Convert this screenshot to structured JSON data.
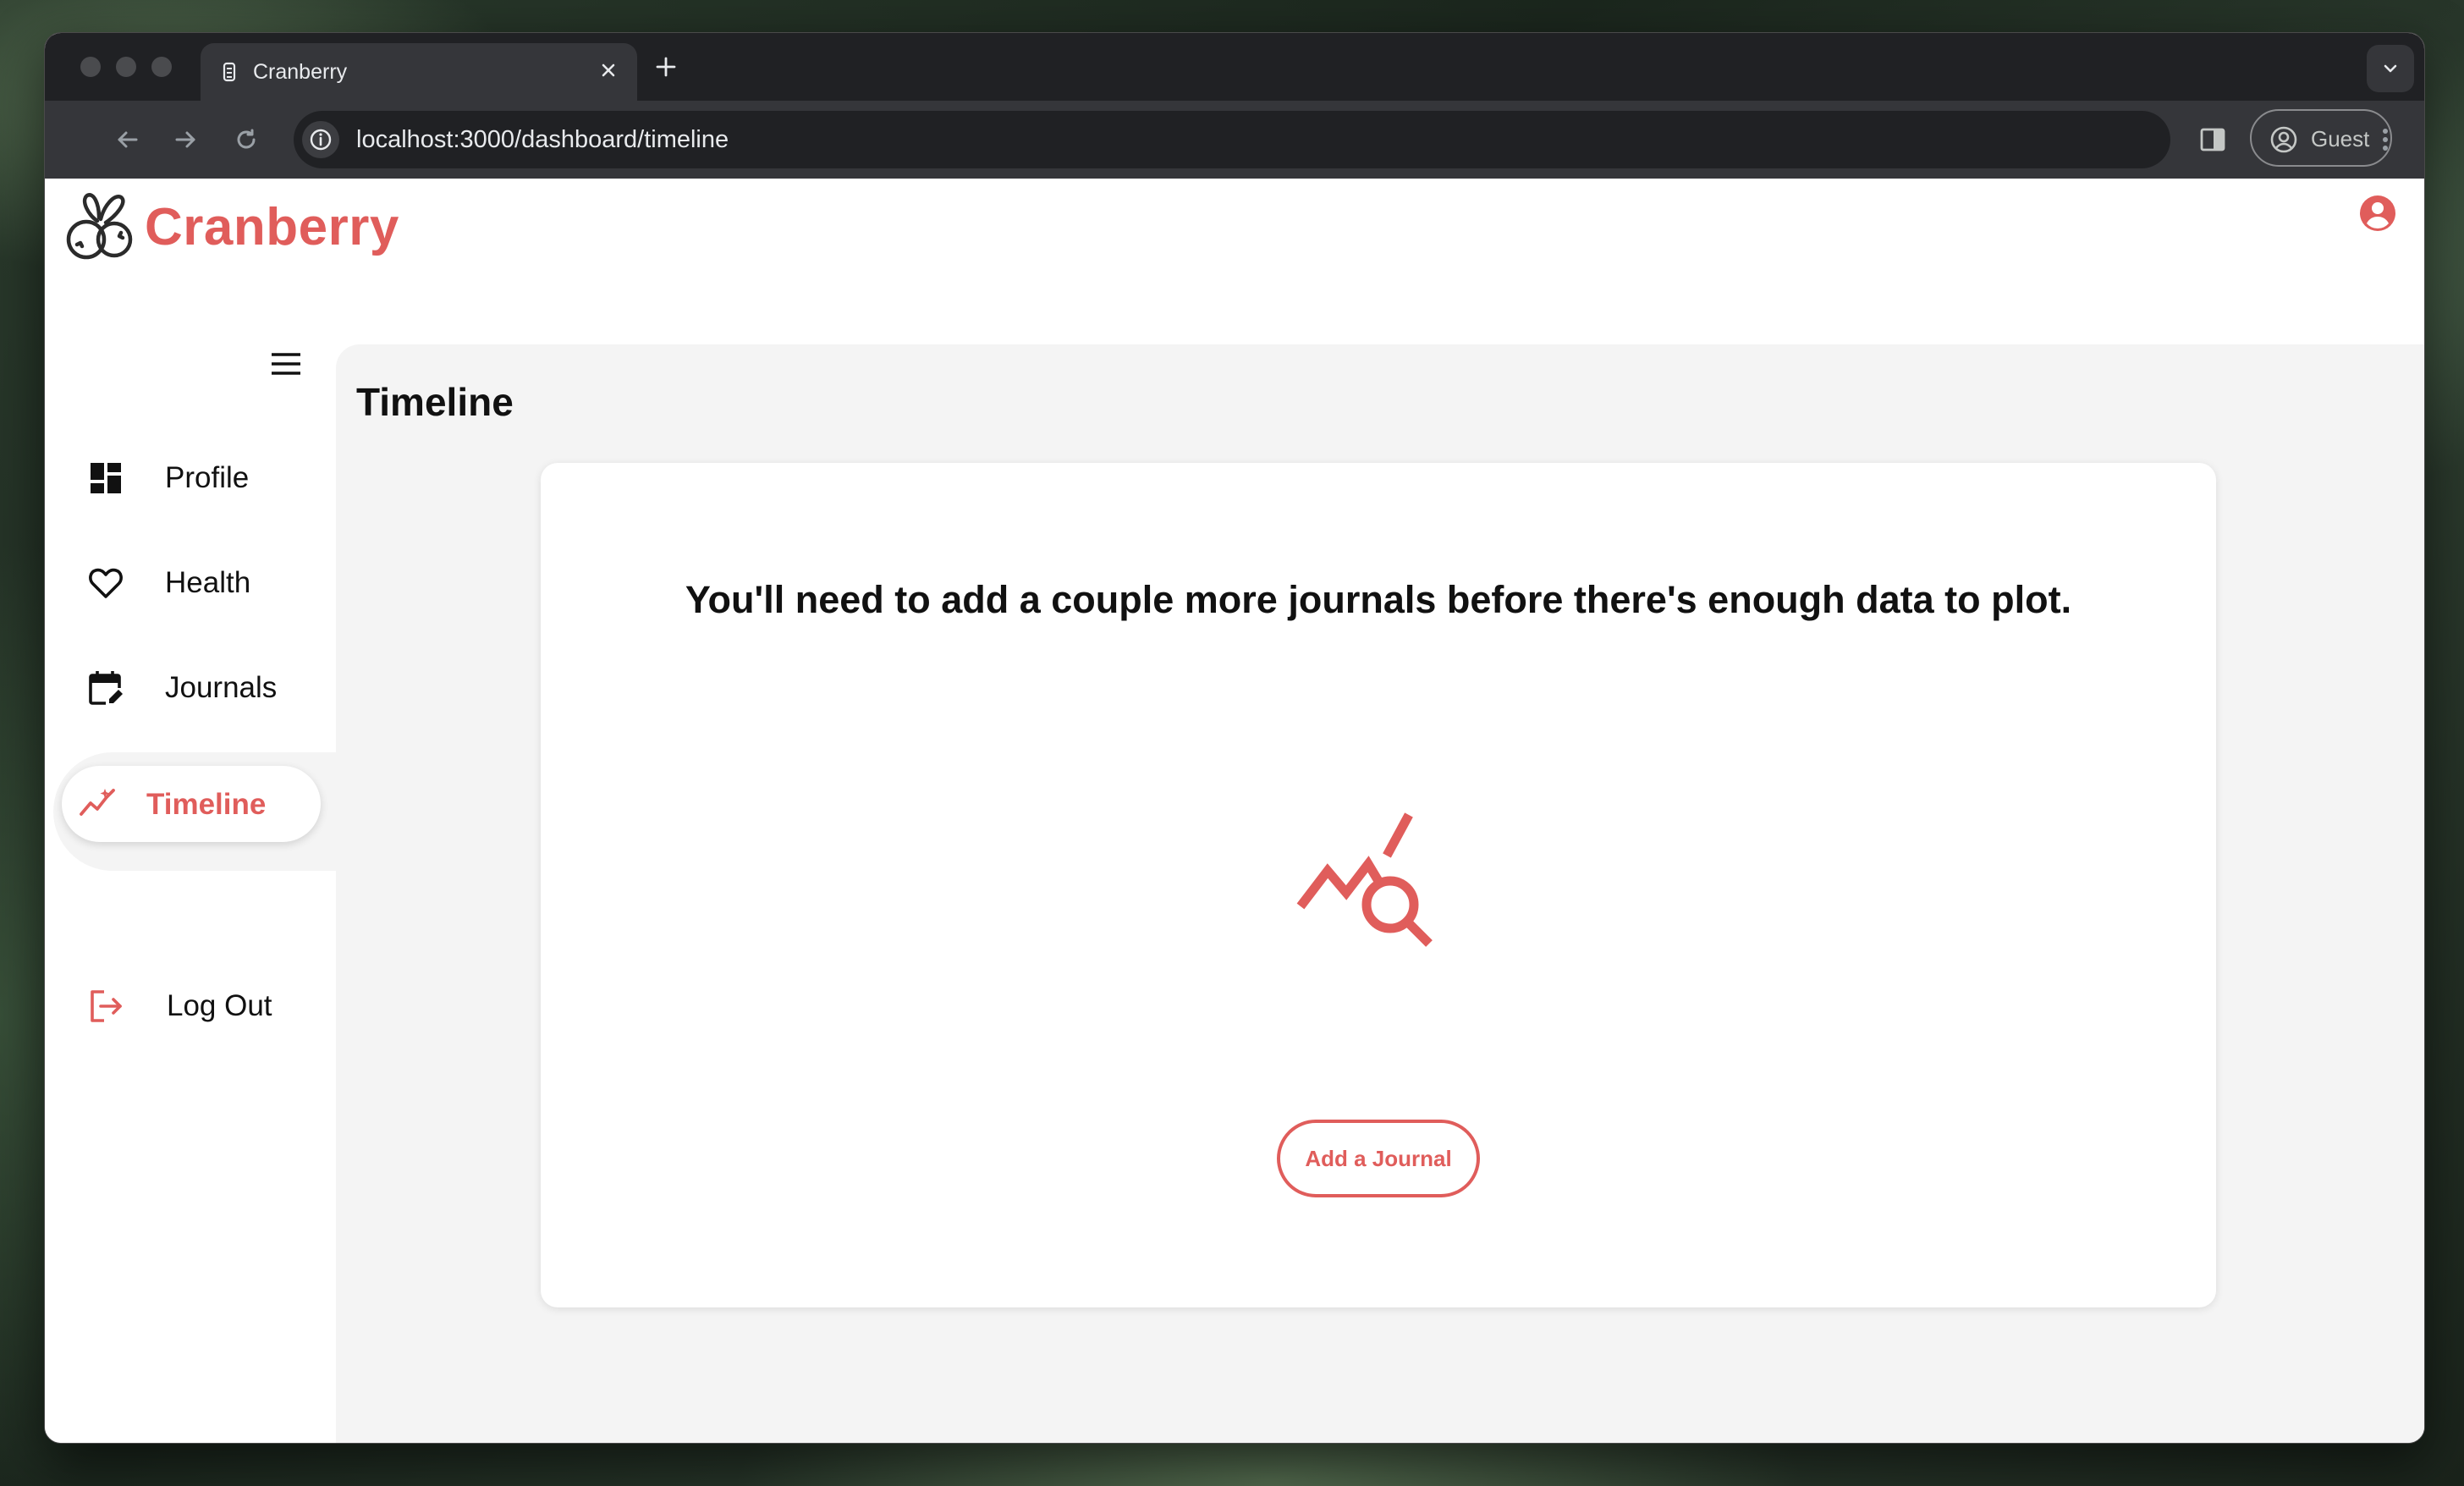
{
  "browser": {
    "tab_title": "Cranberry",
    "url": "localhost:3000/dashboard/timeline",
    "profile_label": "Guest"
  },
  "app": {
    "brand_name": "Cranberry",
    "accent_color": "#e05d5b"
  },
  "sidebar": {
    "items": [
      {
        "label": "Profile",
        "icon": "dashboard-icon"
      },
      {
        "label": "Health",
        "icon": "heart-icon"
      },
      {
        "label": "Journals",
        "icon": "calendar-edit-icon"
      },
      {
        "label": "Timeline",
        "icon": "trending-chart-icon",
        "active": true
      }
    ],
    "logout_label": "Log Out"
  },
  "main": {
    "title": "Timeline",
    "empty_message": "You'll need to add a couple more journals before there's enough data to plot.",
    "empty_icon": "chart-search-icon",
    "add_button_label": "Add a Journal"
  }
}
